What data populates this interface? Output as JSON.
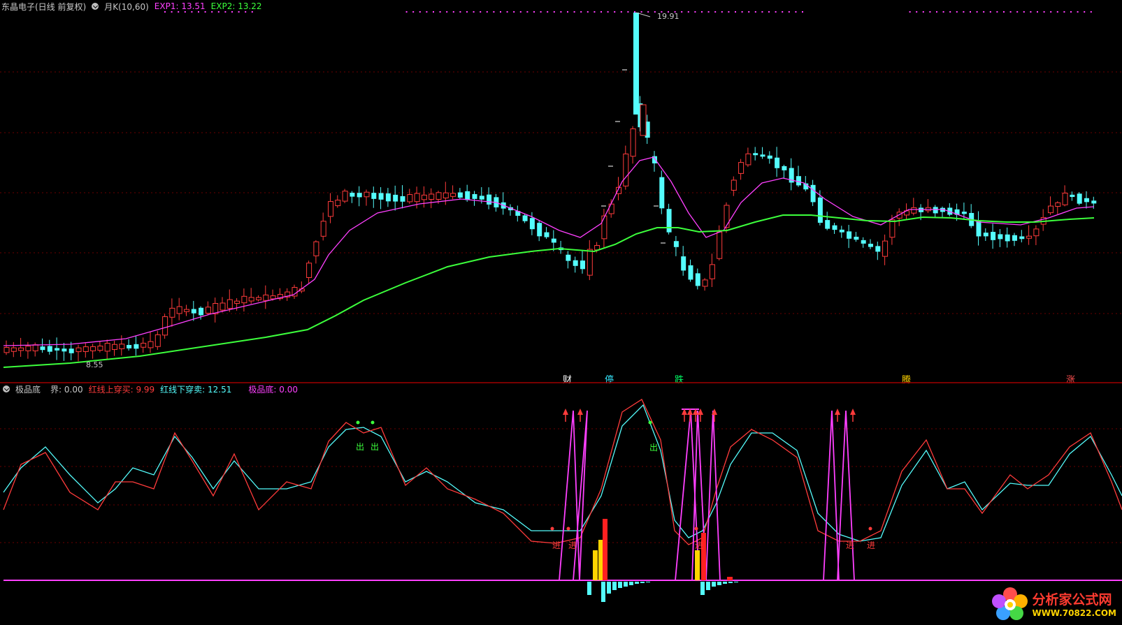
{
  "header": {
    "stock": "东晶电子(日线 前复权)",
    "indicator": "月K(10,60)",
    "exp1": "EXP1: 13.51",
    "exp2": "EXP2: 13.22"
  },
  "main_chart": {
    "high_label": "19.91",
    "low_label": "8.55",
    "markers": [
      {
        "text": "财",
        "color": "#ffffff"
      },
      {
        "text": "停",
        "color": "#36e8ff"
      },
      {
        "text": "跌",
        "color": "#00ff66"
      },
      {
        "text": "腾",
        "color": "#ffd400"
      },
      {
        "text": "涨",
        "color": "#ff5050"
      }
    ]
  },
  "indicator_panel": {
    "name": "极品底",
    "jie": "界: 0.00",
    "up_cross": "红线上穿买: 9.99",
    "down_cross": "红线下穿卖: 12.51",
    "jipin": "极品底: 0.00",
    "signal_out": "出",
    "signal_in": "进"
  },
  "colors": {
    "up_candle": "#ff3b3b",
    "down_candle": "#54fcfc",
    "ma_short": "#ff40ff",
    "ma_long": "#3cff3c",
    "grid": "#6b0000",
    "separator": "#a00000"
  },
  "watermark": {
    "title": "分析家公式网",
    "url": "WWW.70822.COM"
  }
}
